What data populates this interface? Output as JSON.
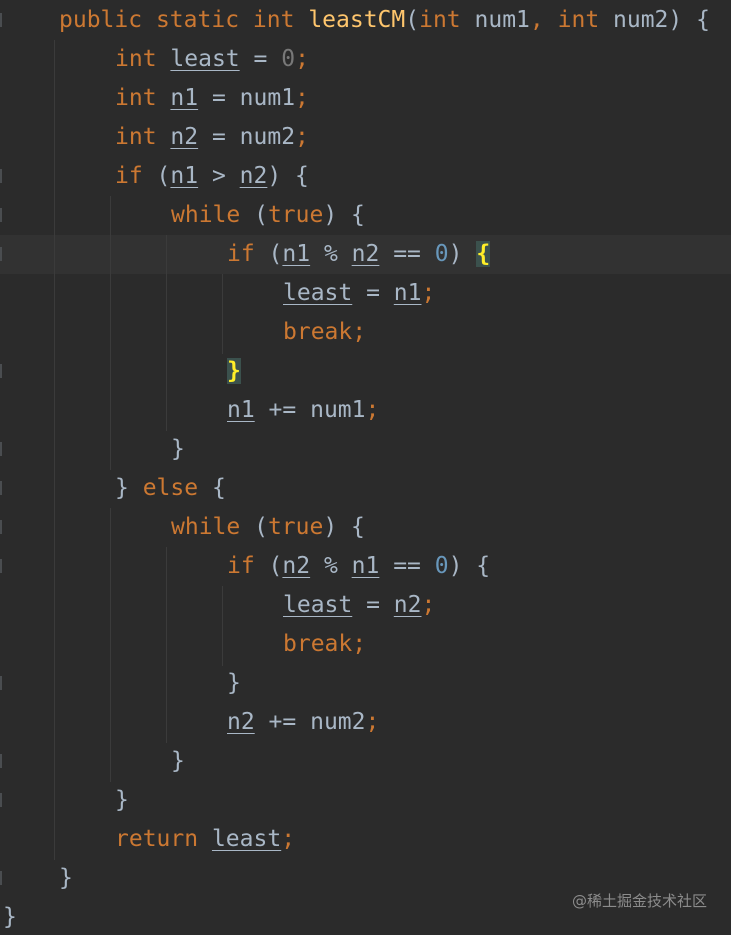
{
  "editor": {
    "lines": [
      {
        "indent": "    ",
        "tokens": [
          {
            "t": "public",
            "c": "kw"
          },
          {
            "t": " "
          },
          {
            "t": "static",
            "c": "kw"
          },
          {
            "t": " "
          },
          {
            "t": "int",
            "c": "kw"
          },
          {
            "t": " "
          },
          {
            "t": "leastCM",
            "c": "fn"
          },
          {
            "t": "("
          },
          {
            "t": "int",
            "c": "kw"
          },
          {
            "t": " num1"
          },
          {
            "t": ",",
            "c": "kw"
          },
          {
            "t": " "
          },
          {
            "t": "int",
            "c": "kw"
          },
          {
            "t": " num2) {"
          }
        ]
      },
      {
        "indent": "        ",
        "tokens": [
          {
            "t": "int",
            "c": "kw"
          },
          {
            "t": " "
          },
          {
            "t": "least",
            "c": "var"
          },
          {
            "t": " = "
          },
          {
            "t": "0",
            "c": "dim"
          },
          {
            "t": ";",
            "c": "kw"
          }
        ]
      },
      {
        "indent": "        ",
        "tokens": [
          {
            "t": "int",
            "c": "kw"
          },
          {
            "t": " "
          },
          {
            "t": "n1",
            "c": "var"
          },
          {
            "t": " = num1"
          },
          {
            "t": ";",
            "c": "kw"
          }
        ]
      },
      {
        "indent": "        ",
        "tokens": [
          {
            "t": "int",
            "c": "kw"
          },
          {
            "t": " "
          },
          {
            "t": "n2",
            "c": "var"
          },
          {
            "t": " = num2"
          },
          {
            "t": ";",
            "c": "kw"
          }
        ]
      },
      {
        "indent": "        ",
        "tokens": [
          {
            "t": "if",
            "c": "kw"
          },
          {
            "t": " ("
          },
          {
            "t": "n1",
            "c": "var"
          },
          {
            "t": " > "
          },
          {
            "t": "n2",
            "c": "var"
          },
          {
            "t": ") {"
          }
        ]
      },
      {
        "indent": "            ",
        "tokens": [
          {
            "t": "while",
            "c": "kw"
          },
          {
            "t": " ("
          },
          {
            "t": "true",
            "c": "kw"
          },
          {
            "t": ") {"
          }
        ]
      },
      {
        "indent": "                ",
        "tokens": [
          {
            "t": "if",
            "c": "kw"
          },
          {
            "t": " ("
          },
          {
            "t": "n1",
            "c": "var"
          },
          {
            "t": " % "
          },
          {
            "t": "n2",
            "c": "var"
          },
          {
            "t": " == "
          },
          {
            "t": "0",
            "c": "num"
          },
          {
            "t": ") "
          },
          {
            "t": "{",
            "c": "brace-hl"
          }
        ]
      },
      {
        "indent": "                    ",
        "tokens": [
          {
            "t": "least",
            "c": "var"
          },
          {
            "t": " = "
          },
          {
            "t": "n1",
            "c": "var"
          },
          {
            "t": ";",
            "c": "kw"
          }
        ]
      },
      {
        "indent": "                    ",
        "tokens": [
          {
            "t": "break",
            "c": "kw"
          },
          {
            "t": ";",
            "c": "kw"
          }
        ]
      },
      {
        "indent": "                ",
        "tokens": [
          {
            "t": "}",
            "c": "brace-hl"
          }
        ]
      },
      {
        "indent": "                ",
        "tokens": [
          {
            "t": "n1",
            "c": "var"
          },
          {
            "t": " += num1"
          },
          {
            "t": ";",
            "c": "kw"
          }
        ]
      },
      {
        "indent": "            ",
        "tokens": [
          {
            "t": "}"
          }
        ]
      },
      {
        "indent": "        ",
        "tokens": [
          {
            "t": "} "
          },
          {
            "t": "else",
            "c": "kw"
          },
          {
            "t": " {"
          }
        ]
      },
      {
        "indent": "            ",
        "tokens": [
          {
            "t": "while",
            "c": "kw"
          },
          {
            "t": " ("
          },
          {
            "t": "true",
            "c": "kw"
          },
          {
            "t": ") {"
          }
        ]
      },
      {
        "indent": "                ",
        "tokens": [
          {
            "t": "if",
            "c": "kw"
          },
          {
            "t": " ("
          },
          {
            "t": "n2",
            "c": "var"
          },
          {
            "t": " % "
          },
          {
            "t": "n1",
            "c": "var"
          },
          {
            "t": " == "
          },
          {
            "t": "0",
            "c": "num"
          },
          {
            "t": ") {"
          }
        ]
      },
      {
        "indent": "                    ",
        "tokens": [
          {
            "t": "least",
            "c": "var"
          },
          {
            "t": " = "
          },
          {
            "t": "n2",
            "c": "var"
          },
          {
            "t": ";",
            "c": "kw"
          }
        ]
      },
      {
        "indent": "                    ",
        "tokens": [
          {
            "t": "break",
            "c": "kw"
          },
          {
            "t": ";",
            "c": "kw"
          }
        ]
      },
      {
        "indent": "                ",
        "tokens": [
          {
            "t": "}"
          }
        ]
      },
      {
        "indent": "                ",
        "tokens": [
          {
            "t": "n2",
            "c": "var"
          },
          {
            "t": " += num2"
          },
          {
            "t": ";",
            "c": "kw"
          }
        ]
      },
      {
        "indent": "            ",
        "tokens": [
          {
            "t": "}"
          }
        ]
      },
      {
        "indent": "        ",
        "tokens": [
          {
            "t": "}"
          }
        ]
      },
      {
        "indent": "        ",
        "tokens": [
          {
            "t": "return",
            "c": "kw"
          },
          {
            "t": " "
          },
          {
            "t": "least",
            "c": "var"
          },
          {
            "t": ";",
            "c": "kw"
          }
        ]
      },
      {
        "indent": "    ",
        "tokens": [
          {
            "t": "}"
          }
        ]
      },
      {
        "indent": "",
        "tokens": [
          {
            "t": "}"
          }
        ]
      }
    ]
  },
  "watermark": "@稀土掘金技术社区",
  "colors": {
    "background": "#2b2b2b",
    "keyword": "#cc7832",
    "function": "#ffc66d",
    "number": "#6897bb",
    "text": "#a9b7c6",
    "brace_highlight": "#ffef28"
  }
}
